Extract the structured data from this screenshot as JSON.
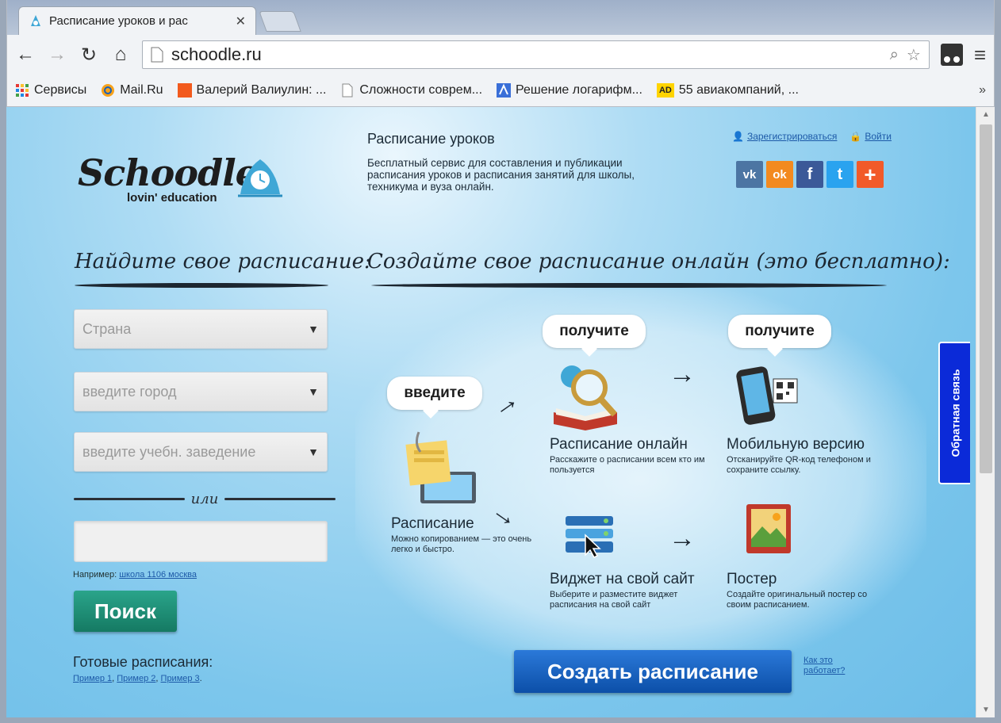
{
  "browser": {
    "tab_title": "Расписание уроков и рас",
    "tab_close": "✕",
    "url": "schoodle.ru",
    "bookmarks": [
      {
        "label": "Сервисы",
        "icon": "apps-grid-icon"
      },
      {
        "label": "Mail.Ru",
        "icon": "mailru-icon"
      },
      {
        "label": "Валерий Валиулин: ...",
        "icon": "orange-square-icon"
      },
      {
        "label": "Сложности соврем...",
        "icon": "page-icon"
      },
      {
        "label": "Решение логарифм...",
        "icon": "math-icon"
      },
      {
        "label": "55 авиакомпаний, ...",
        "icon": "ad-icon"
      }
    ],
    "bookmarks_more": "»"
  },
  "site": {
    "logo_text": "Schoodle",
    "logo_sub": "lovin' education",
    "intro_title": "Расписание уроков",
    "intro_text": "Бесплатный сервис для составления и публикации расписания уроков и расписания занятий для школы, техникума и вуза онлайн.",
    "register": "Зарегистрироваться",
    "login": "Войти",
    "social": [
      {
        "name": "vk-icon",
        "glyph": "vk",
        "color": "#4c75a3"
      },
      {
        "name": "odnoklassniki-icon",
        "glyph": "ok",
        "color": "#f38a1f"
      },
      {
        "name": "facebook-icon",
        "glyph": "f",
        "color": "#3b5998"
      },
      {
        "name": "twitter-icon",
        "glyph": "t",
        "color": "#2aa3ef"
      },
      {
        "name": "plus-share-icon",
        "glyph": "+",
        "color": "#f25a29"
      }
    ]
  },
  "find": {
    "heading": "Найдите свое расписание:",
    "country_placeholder": "Страна",
    "city_placeholder": "введите город",
    "school_placeholder": "введите учебн. заведение",
    "or_text": "или",
    "example_label": "Например:",
    "example_link": "школа 1106 москва",
    "search_button": "Поиск",
    "ready_title": "Готовые расписания:",
    "ready_links": [
      "Пример 1",
      "Пример 2",
      "Пример 3"
    ]
  },
  "create": {
    "heading": "Создайте свое расписание онлайн (это бесплатно):",
    "bubble_enter": "введите",
    "bubble_get1": "получите",
    "bubble_get2": "получите",
    "schedule_title": "Расписание",
    "schedule_text": "Можно копированием — это очень легко и быстро.",
    "online_title": "Расписание онлайн",
    "online_text": "Расскажите о расписании всем кто им пользуется",
    "mobile_title": "Мобильную версию",
    "mobile_text": "Отсканируйте QR-код телефоном и сохраните ссылку.",
    "widget_title": "Виджет на свой сайт",
    "widget_text": "Выберите и разместите виджет расписания на свой сайт",
    "poster_title": "Постер",
    "poster_text": "Создайте оригинальный постер со своим расписанием.",
    "create_button": "Создать расписание",
    "how_link": "Как это работает?"
  },
  "feedback": "Обратная связь"
}
